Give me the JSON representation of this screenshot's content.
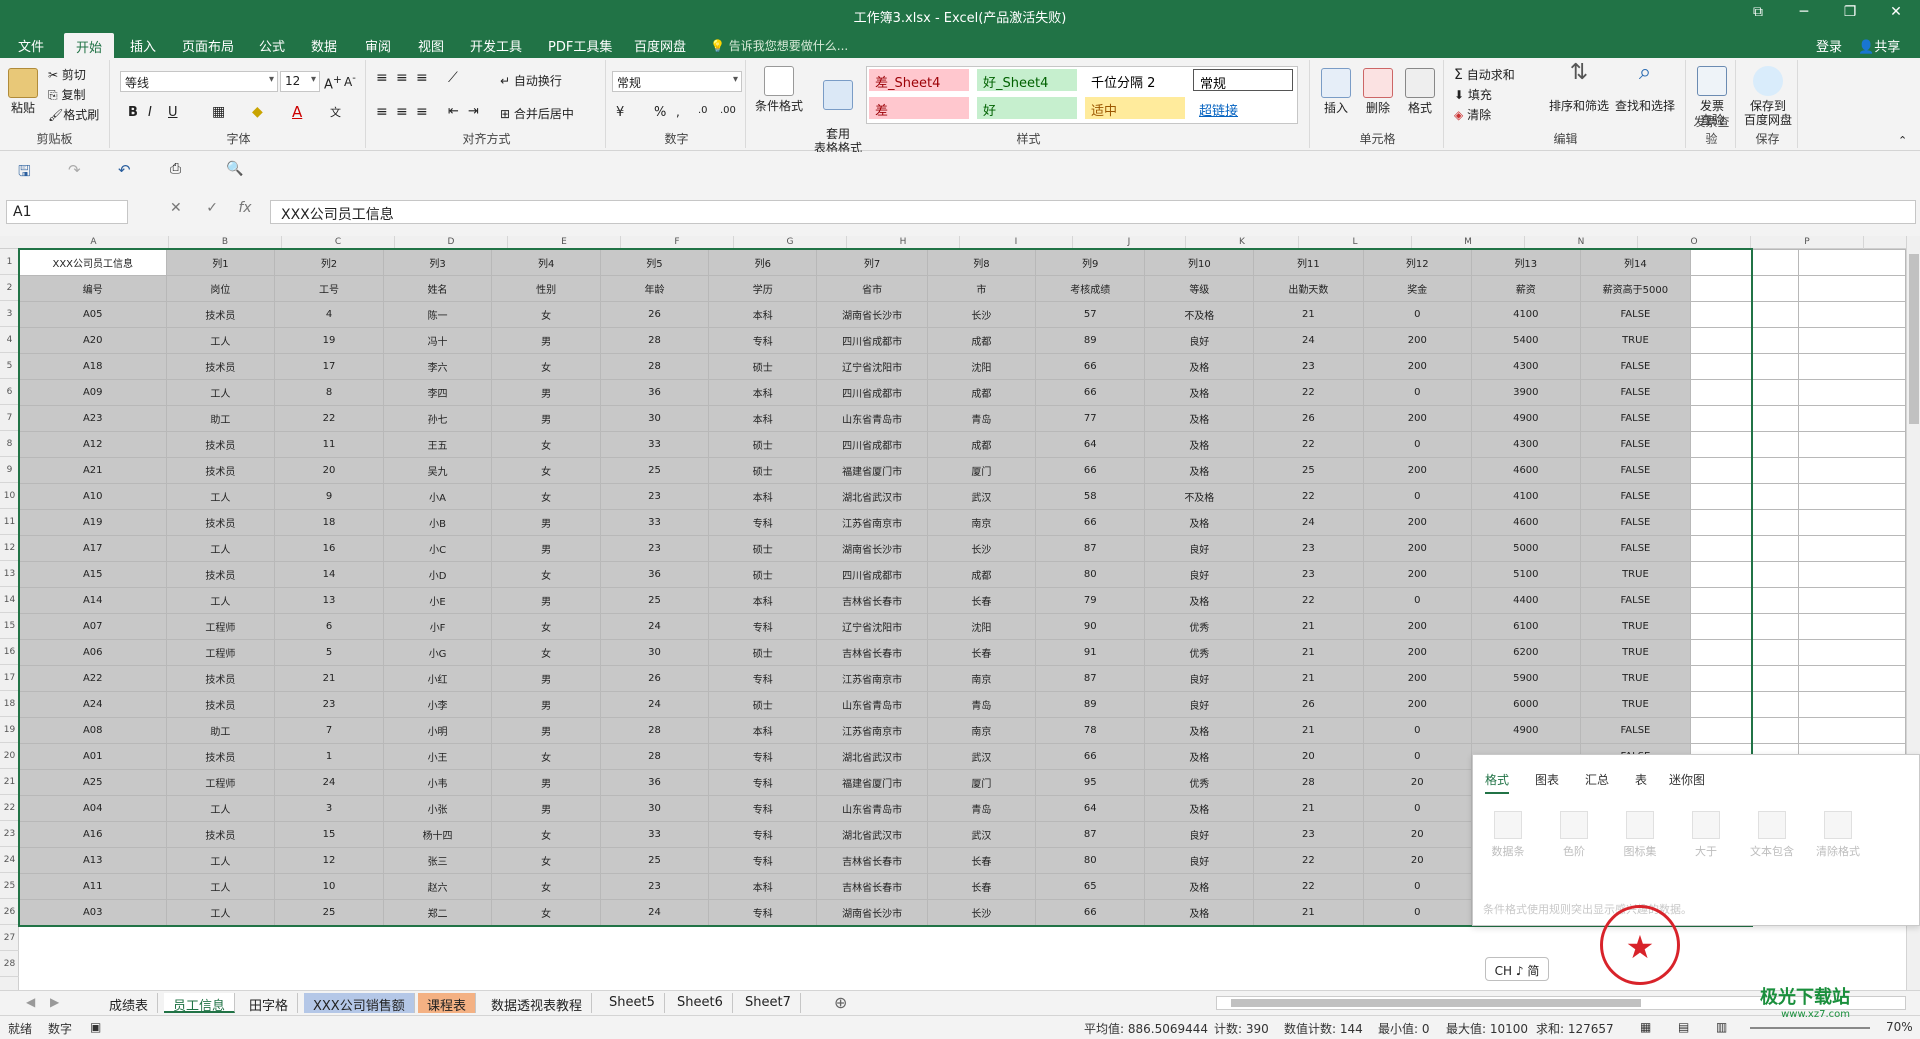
{
  "window": {
    "title": "工作簿3.xlsx - Excel(产品激活失败)",
    "minimize": "─",
    "restore": "❐",
    "close": "✕",
    "ribbon_opts": "⧉"
  },
  "menu": {
    "tabs": [
      "文件",
      "开始",
      "插入",
      "页面布局",
      "公式",
      "数据",
      "审阅",
      "视图",
      "开发工具",
      "PDF工具集",
      "百度网盘"
    ],
    "tell_me": "告诉我您想要做什么...",
    "login": "登录",
    "share": "共享"
  },
  "ribbon": {
    "clipboard": {
      "paste": "粘贴",
      "cut": "剪切",
      "copy": "复制",
      "format_painter": "格式刷",
      "label": "剪贴板"
    },
    "font": {
      "name": "等线",
      "size": "12",
      "bold": "B",
      "italic": "I",
      "underline": "U",
      "label": "字体"
    },
    "align": {
      "wrap": "自动换行",
      "merge": "合并后居中",
      "label": "对齐方式"
    },
    "number": {
      "format": "常规",
      "percent": "%",
      "label": "数字"
    },
    "styles": {
      "cond": "条件格式",
      "table": "套用\n表格格式",
      "cells": [
        "差_Sheet4",
        "好_Sheet4",
        "千位分隔 2",
        "常规",
        "差",
        "好",
        "适中",
        "超链接"
      ],
      "label": "样式"
    },
    "cells": {
      "insert": "插入",
      "delete": "删除",
      "format": "格式",
      "label": "单元格"
    },
    "edit": {
      "autosum": "自动求和",
      "fill": "填充",
      "clear": "清除",
      "sort": "排序和筛选",
      "find": "查找和选择",
      "label": "编辑"
    },
    "invoice": {
      "btn": "发票\n查验",
      "label": "发票查验"
    },
    "save": {
      "btn": "保存到\n百度网盘",
      "label": "保存"
    }
  },
  "formula": {
    "namebox": "A1",
    "fx": "fx",
    "value": "XXX公司员工信息"
  },
  "columns": [
    "A",
    "B",
    "C",
    "D",
    "E",
    "F",
    "G",
    "H",
    "I",
    "J",
    "K",
    "L",
    "M",
    "N",
    "O",
    "P"
  ],
  "table": {
    "header": [
      "XXX公司员工信息",
      "列1",
      "列2",
      "列3",
      "列4",
      "列5",
      "列6",
      "列7",
      "列8",
      "列9",
      "列10",
      "列11",
      "列12",
      "列13",
      "列14"
    ],
    "fields": [
      "编号",
      "岗位",
      "工号",
      "姓名",
      "性别",
      "年龄",
      "学历",
      "省市",
      "市",
      "考核成绩",
      "等级",
      "出勤天数",
      "奖金",
      "薪资",
      "薪资高于5000"
    ],
    "rows": [
      [
        "A05",
        "技术员",
        "4",
        "陈一",
        "女",
        "26",
        "本科",
        "湖南省长沙市",
        "长沙",
        "57",
        "不及格",
        "21",
        "0",
        "4100",
        "FALSE"
      ],
      [
        "A20",
        "工人",
        "19",
        "冯十",
        "男",
        "28",
        "专科",
        "四川省成都市",
        "成都",
        "89",
        "良好",
        "24",
        "200",
        "5400",
        "TRUE"
      ],
      [
        "A18",
        "技术员",
        "17",
        "李六",
        "女",
        "28",
        "硕士",
        "辽宁省沈阳市",
        "沈阳",
        "66",
        "及格",
        "23",
        "200",
        "4300",
        "FALSE"
      ],
      [
        "A09",
        "工人",
        "8",
        "李四",
        "男",
        "36",
        "本科",
        "四川省成都市",
        "成都",
        "66",
        "及格",
        "22",
        "0",
        "3900",
        "FALSE"
      ],
      [
        "A23",
        "助工",
        "22",
        "孙七",
        "男",
        "30",
        "本科",
        "山东省青岛市",
        "青岛",
        "77",
        "及格",
        "26",
        "200",
        "4900",
        "FALSE"
      ],
      [
        "A12",
        "技术员",
        "11",
        "王五",
        "女",
        "33",
        "硕士",
        "四川省成都市",
        "成都",
        "64",
        "及格",
        "22",
        "0",
        "4300",
        "FALSE"
      ],
      [
        "A21",
        "技术员",
        "20",
        "吴九",
        "女",
        "25",
        "硕士",
        "福建省厦门市",
        "厦门",
        "66",
        "及格",
        "25",
        "200",
        "4600",
        "FALSE"
      ],
      [
        "A10",
        "工人",
        "9",
        "小A",
        "女",
        "23",
        "本科",
        "湖北省武汉市",
        "武汉",
        "58",
        "不及格",
        "22",
        "0",
        "4100",
        "FALSE"
      ],
      [
        "A19",
        "技术员",
        "18",
        "小B",
        "男",
        "33",
        "专科",
        "江苏省南京市",
        "南京",
        "66",
        "及格",
        "24",
        "200",
        "4600",
        "FALSE"
      ],
      [
        "A17",
        "工人",
        "16",
        "小C",
        "男",
        "23",
        "硕士",
        "湖南省长沙市",
        "长沙",
        "87",
        "良好",
        "23",
        "200",
        "5000",
        "FALSE"
      ],
      [
        "A15",
        "技术员",
        "14",
        "小D",
        "女",
        "36",
        "硕士",
        "四川省成都市",
        "成都",
        "80",
        "良好",
        "23",
        "200",
        "5100",
        "TRUE"
      ],
      [
        "A14",
        "工人",
        "13",
        "小E",
        "男",
        "25",
        "本科",
        "吉林省长春市",
        "长春",
        "79",
        "及格",
        "22",
        "0",
        "4400",
        "FALSE"
      ],
      [
        "A07",
        "工程师",
        "6",
        "小F",
        "女",
        "24",
        "专科",
        "辽宁省沈阳市",
        "沈阳",
        "90",
        "优秀",
        "21",
        "200",
        "6100",
        "TRUE"
      ],
      [
        "A06",
        "工程师",
        "5",
        "小G",
        "女",
        "30",
        "硕士",
        "吉林省长春市",
        "长春",
        "91",
        "优秀",
        "21",
        "200",
        "6200",
        "TRUE"
      ],
      [
        "A22",
        "技术员",
        "21",
        "小红",
        "男",
        "26",
        "专科",
        "江苏省南京市",
        "南京",
        "87",
        "良好",
        "21",
        "200",
        "5900",
        "TRUE"
      ],
      [
        "A24",
        "技术员",
        "23",
        "小李",
        "男",
        "24",
        "硕士",
        "山东省青岛市",
        "青岛",
        "89",
        "良好",
        "26",
        "200",
        "6000",
        "TRUE"
      ],
      [
        "A08",
        "助工",
        "7",
        "小明",
        "男",
        "28",
        "本科",
        "江苏省南京市",
        "南京",
        "78",
        "及格",
        "21",
        "0",
        "4900",
        "FALSE"
      ],
      [
        "A01",
        "技术员",
        "1",
        "小王",
        "女",
        "28",
        "专科",
        "湖北省武汉市",
        "武汉",
        "66",
        "及格",
        "20",
        "0",
        "",
        "FALSE"
      ],
      [
        "A25",
        "工程师",
        "24",
        "小韦",
        "男",
        "36",
        "专科",
        "福建省厦门市",
        "厦门",
        "95",
        "优秀",
        "28",
        "20",
        "",
        ""
      ],
      [
        "A04",
        "工人",
        "3",
        "小张",
        "男",
        "30",
        "专科",
        "山东省青岛市",
        "青岛",
        "64",
        "及格",
        "21",
        "0",
        "",
        ""
      ],
      [
        "A16",
        "技术员",
        "15",
        "杨十四",
        "女",
        "33",
        "专科",
        "湖北省武汉市",
        "武汉",
        "87",
        "良好",
        "23",
        "20",
        "",
        ""
      ],
      [
        "A13",
        "工人",
        "12",
        "张三",
        "女",
        "25",
        "专科",
        "吉林省长春市",
        "长春",
        "80",
        "良好",
        "22",
        "20",
        "",
        ""
      ],
      [
        "A11",
        "工人",
        "10",
        "赵六",
        "女",
        "23",
        "本科",
        "吉林省长春市",
        "长春",
        "65",
        "及格",
        "22",
        "0",
        "",
        ""
      ],
      [
        "A03",
        "工人",
        "25",
        "郑二",
        "女",
        "24",
        "专科",
        "湖南省长沙市",
        "长沙",
        "66",
        "及格",
        "21",
        "0",
        "",
        ""
      ]
    ]
  },
  "row_numbers": [
    "1",
    "2",
    "3",
    "4",
    "5",
    "6",
    "7",
    "8",
    "9",
    "10",
    "11",
    "12",
    "13",
    "14",
    "15",
    "16",
    "17",
    "18",
    "19",
    "20",
    "21",
    "22",
    "23",
    "24",
    "25",
    "26",
    "27",
    "28"
  ],
  "quick_analysis": {
    "tabs": [
      "格式",
      "图表",
      "汇总",
      "表",
      "迷你图"
    ],
    "items": [
      "数据条",
      "色阶",
      "图标集",
      "大于",
      "文本包含",
      "清除格式"
    ],
    "desc": "条件格式使用规则突出显示感兴趣的数据。"
  },
  "ime": "CH ♪ 简",
  "sheets": [
    "成绩表",
    "员工信息",
    "田字格",
    "XXX公司销售额",
    "课程表",
    "数据透视表教程",
    "Sheet5",
    "Sheet6",
    "Sheet7"
  ],
  "add_sheet": "⊕",
  "status": {
    "ready": "就绪",
    "mode": "数字",
    "avg": "平均值: 886.5069444",
    "count": "计数: 390",
    "numcount": "数值计数: 144",
    "min": "最小值: 0",
    "max": "最大值: 10100",
    "sum": "求和: 127657",
    "zoom": "70%"
  },
  "watermark": {
    "name": "极光下载站",
    "url": "www.xz7.com"
  },
  "colors": {
    "excel_green": "#217346",
    "selection_fill": "#c8c8c8",
    "bad_fill": "#ffc7ce",
    "good_fill": "#c6efce",
    "neutral_fill": "#ffeb9c"
  }
}
